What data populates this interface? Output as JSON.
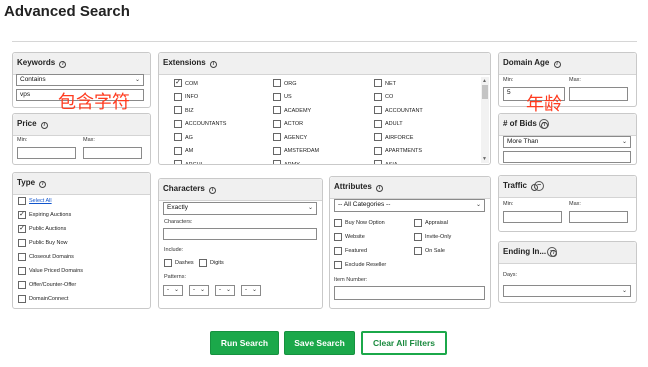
{
  "page": {
    "title": "Advanced Search"
  },
  "keywords": {
    "title": "Keywords",
    "match_mode": "Contains",
    "value": "vps",
    "annotation": "包含字符"
  },
  "price": {
    "title": "Price",
    "min_label": "Min:",
    "max_label": "Max:"
  },
  "extensions": {
    "title": "Extensions",
    "col1": [
      "COM",
      "INFO",
      "BIZ",
      "ACCOUNTANTS",
      "AG",
      "AM",
      "ARCHI"
    ],
    "col2": [
      "ORG",
      "US",
      "ACADEMY",
      "ACTOR",
      "AGENCY",
      "AMSTERDAM",
      "ARMY"
    ],
    "col3": [
      "NET",
      "CO",
      "ACCOUNTANT",
      "ADULT",
      "AIRFORCE",
      "APARTMENTS",
      "ASIA"
    ],
    "checked": [
      "COM"
    ]
  },
  "domain_age": {
    "title": "Domain Age",
    "min_label": "Min:",
    "max_label": "Max:",
    "min_value": "5",
    "annotation": "年龄"
  },
  "bids": {
    "title": "# of Bids",
    "mode": "More Than"
  },
  "type": {
    "title": "Type",
    "select_all": "Select All",
    "items": [
      {
        "label": "Expiring Auctions",
        "checked": true
      },
      {
        "label": "Public Auctions",
        "checked": true
      },
      {
        "label": "Public Buy Now",
        "checked": false
      },
      {
        "label": "Closeout Domains",
        "checked": false
      },
      {
        "label": "Value Priced Domains",
        "checked": false
      },
      {
        "label": "Offer/Counter-Offer",
        "checked": false
      },
      {
        "label": "DomainConnect",
        "checked": false
      }
    ]
  },
  "characters": {
    "title": "Characters",
    "mode": "Exactly",
    "characters_label": "Characters:",
    "include_label": "Include:",
    "dashes": "Dashes",
    "digits": "Digits",
    "patterns_label": "Patterns:",
    "pattern_value": "-"
  },
  "attributes": {
    "title": "Attributes",
    "category": "-- All Categories --",
    "left": [
      "Buy Now Option",
      "Website",
      "Featured",
      "Exclude Reseller"
    ],
    "right": [
      "Appraisal",
      "Invite-Only",
      "On Sale"
    ],
    "item_number_label": "Item Number:"
  },
  "traffic": {
    "title": "Traffic",
    "min_label": "Min:",
    "max_label": "Max:"
  },
  "ending": {
    "title": "Ending In...",
    "days_label": "Days:"
  },
  "buttons": {
    "run": "Run Search",
    "save": "Save Search",
    "clear": "Clear All Filters"
  },
  "icons": {
    "info": "info-icon",
    "collapse": "minus-circle-icon",
    "dropdown": "chevron-down-icon"
  },
  "colors": {
    "accent_green": "#1ba84a",
    "annotation_red": "#ff3b1f"
  }
}
